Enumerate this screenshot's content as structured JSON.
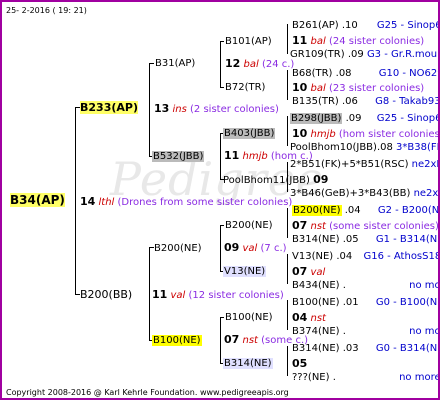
{
  "header": {
    "date": "25- 2-2016 ( 19: 21)"
  },
  "footer": {
    "copyright": "Copyright 2008-2016 @ Karl Kehrle Foundation.   www.pedigreeapis.org"
  },
  "watermark": "Pedigree",
  "root": {
    "label": "B34(AP)",
    "gen": "14",
    "breed": "lthl",
    "note": "(Drones from some sister colonies)"
  },
  "gen1": {
    "top": {
      "label": "B233(AP)",
      "gen": "13",
      "breed": "ins",
      "note": "(2 sister colonies)"
    },
    "bottom": {
      "label": "B200(BB)",
      "gen": "11",
      "breed": "val",
      "note": "(12 sister colonies)"
    }
  },
  "gen2": {
    "b31": {
      "label": "B31(AP)"
    },
    "b532": {
      "label": "B532(JBB)",
      "gen": "11",
      "breed": "hmjb",
      "note": "(hom c.)"
    },
    "b200ne": {
      "label": "B200(NE)",
      "gen": "09",
      "breed": "val",
      "note": "(7 c.)"
    },
    "b100ne": {
      "label": "B100(NE)",
      "gen": "07",
      "breed": "nst",
      "note": "(some c.)"
    }
  },
  "gen3": {
    "b101": {
      "label": "B101(AP)",
      "gen": "12",
      "breed": "bal",
      "note": "(24 c.)"
    },
    "b72": {
      "label": "B72(TR)"
    },
    "b403": {
      "label": "B403(JBB)",
      "gen": "10",
      "breed": "hmjb"
    },
    "poolb": {
      "label": "PoolBhom11(JBB)",
      "gen": "09"
    },
    "b200ne2": {
      "label": "B200(NE)",
      "gen": "07",
      "breed": "nst"
    },
    "v13": {
      "label": "V13(NE)",
      "gen": "07",
      "breed": "val"
    },
    "b100ne2": {
      "label": "B100(NE)",
      "gen": "04",
      "breed": "nst"
    },
    "b314": {
      "label": "B314(NE)",
      "gen": "05"
    }
  },
  "gen4": [
    {
      "label": "B261(AP)",
      "year": ".10",
      "ref": "G25 - Sinop62R"
    },
    {
      "gen": "11",
      "breed": "bal",
      "note": "(24 sister colonies)"
    },
    {
      "label": "GR109(TR)",
      "year": ".09",
      "ref": "G3 - Gr.R.mounta"
    },
    {
      "label": "B68(TR)",
      "year": ".08",
      "ref": "G10 - NO6294R"
    },
    {
      "gen": "10",
      "breed": "bal",
      "note": "(23 sister colonies)"
    },
    {
      "label": "B135(TR)",
      "year": ".06",
      "ref": "G8 - Takab93aR"
    },
    {
      "label": "B298(JBB)",
      "year": ".09",
      "ref": "G25 - Sinop62R"
    },
    {
      "gen": "10",
      "breed": "hmjb",
      "note": "(hom sister colonies)"
    },
    {
      "label": "PoolBhom10(JBB)",
      "year": ".08",
      "ref": "3*B38(FK)+3"
    },
    {
      "label": "2*B51(FK)+5*B51(RSC)",
      "ref": "ne2xB306("
    },
    {
      "label": "3*B46(GeB)+3*B43(BB)",
      "ref": "ne2xB95(A"
    },
    {
      "label": "B200(NE)",
      "year": ".04",
      "ref": "G2 - B200(NE)"
    },
    {
      "gen": "07",
      "breed": "nst",
      "note": "(some sister colonies)"
    },
    {
      "label": "B314(NE)",
      "year": ".05",
      "ref": "G1 - B314(NE)"
    },
    {
      "label": "V13(NE)",
      "year": ".04",
      "ref": "G16 - AthosS180R"
    },
    {
      "gen": "07",
      "breed": "val"
    },
    {
      "label": "B434(NE)",
      "year": ".",
      "ref": "no more"
    },
    {
      "label": "B100(NE)",
      "year": ".01",
      "ref": "G0 - B100(NE)"
    },
    {
      "gen": "04",
      "breed": "nst"
    },
    {
      "label": "B374(NE)",
      "year": ".",
      "ref": "no more"
    },
    {
      "label": "B314(NE)",
      "year": ".03",
      "ref": "G0 - B314(NE)"
    },
    {
      "gen": "05"
    },
    {
      "label": "???(NE)",
      "year": ".",
      "ref": "no more"
    }
  ]
}
